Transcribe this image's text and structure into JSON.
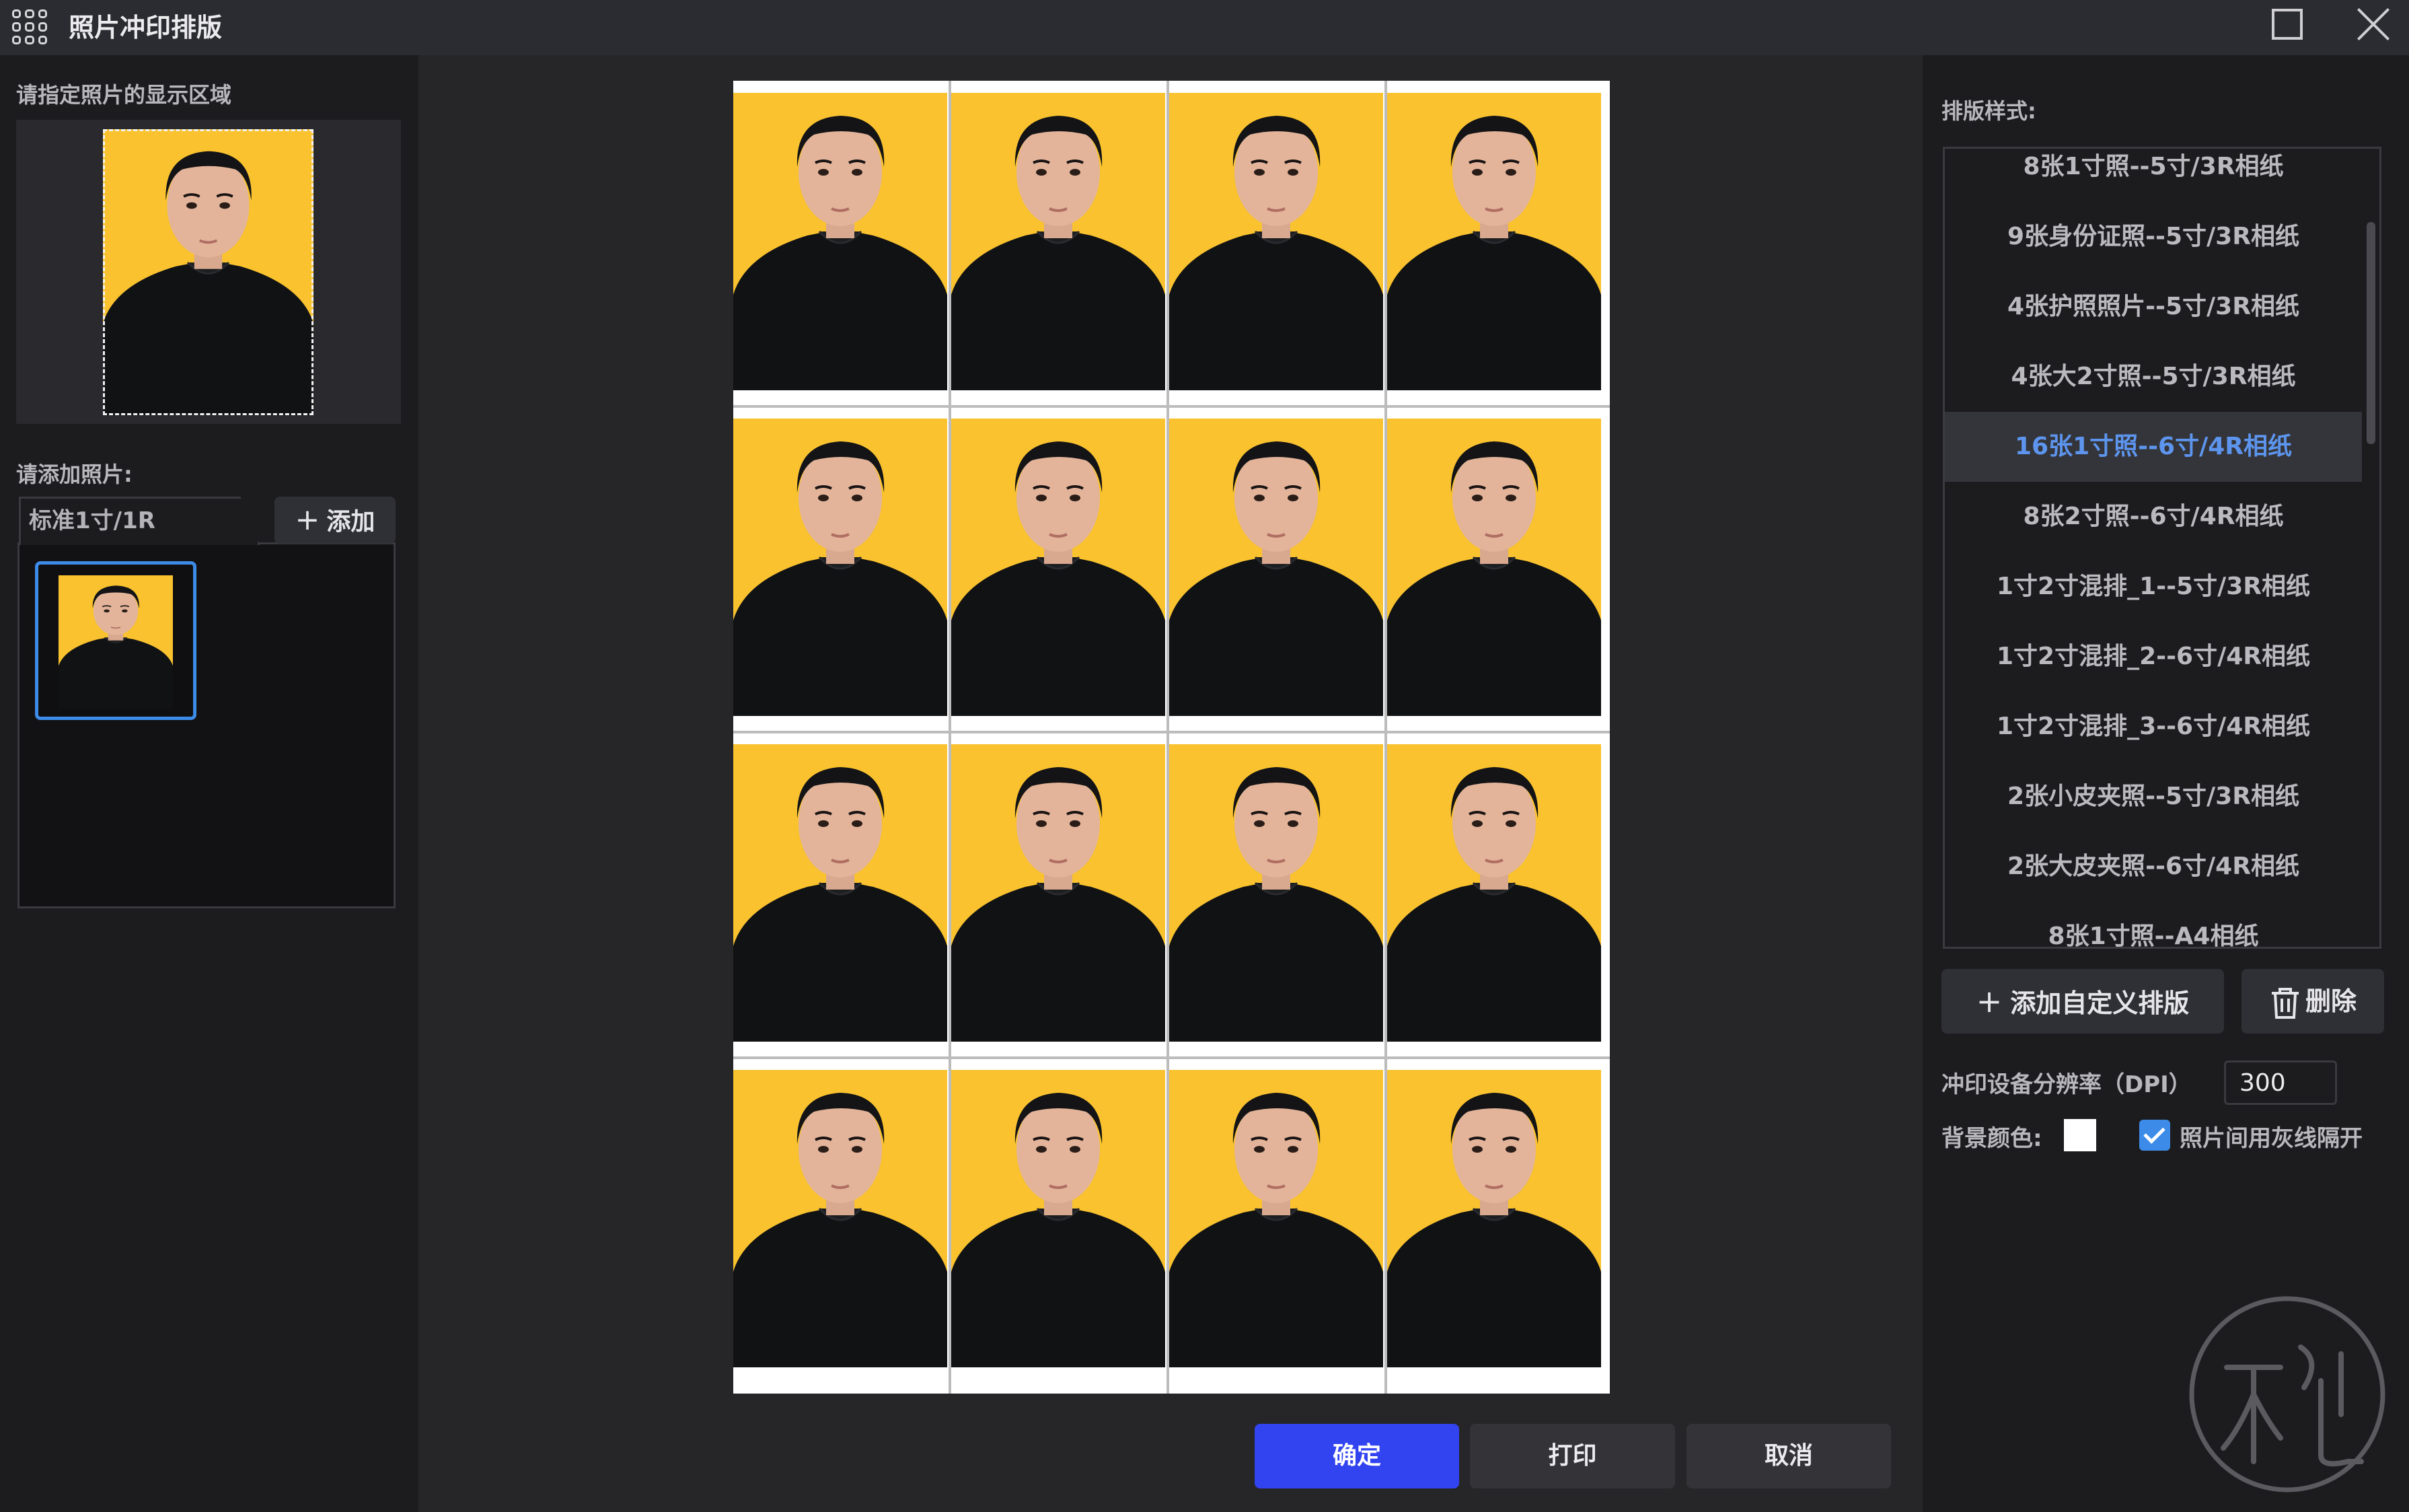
{
  "window": {
    "title": "照片冲印排版",
    "maximize_icon": "maximize-icon",
    "close_icon": "close-icon"
  },
  "left": {
    "crop_label": "请指定照片的显示区域",
    "add_label": "请添加照片:",
    "tab_label": "标准1寸/1R",
    "add_button": "添加"
  },
  "preview": {
    "rows": 4,
    "cols": 4,
    "background_color": "#ffffff",
    "photo_background": "#f9c22e",
    "gray_separator": true
  },
  "right": {
    "layout_label": "排版样式:",
    "styles": [
      "8张1寸照--5寸/3R相纸",
      "9张身份证照--5寸/3R相纸",
      "4张护照照片--5寸/3R相纸",
      "4张大2寸照--5寸/3R相纸",
      "16张1寸照--6寸/4R相纸",
      "8张2寸照--6寸/4R相纸",
      "1寸2寸混排_1--5寸/3R相纸",
      "1寸2寸混排_2--6寸/4R相纸",
      "1寸2寸混排_3--6寸/4R相纸",
      "2张小皮夹照--5寸/3R相纸",
      "2张大皮夹照--6寸/4R相纸",
      "8张1寸照--A4相纸"
    ],
    "selected_index": 4,
    "add_custom_button": "添加自定义排版",
    "delete_button": "删除",
    "dpi_label": "冲印设备分辨率（DPI）",
    "dpi_value": "300",
    "bg_color_label": "背景颜色:",
    "separator_label": "照片间用灰线隔开",
    "separator_checked": true
  },
  "buttons": {
    "ok": "确定",
    "print": "打印",
    "cancel": "取消"
  },
  "colors": {
    "accent": "#3243f0",
    "selected_text": "#5d95ee",
    "check": "#3d8be8"
  }
}
